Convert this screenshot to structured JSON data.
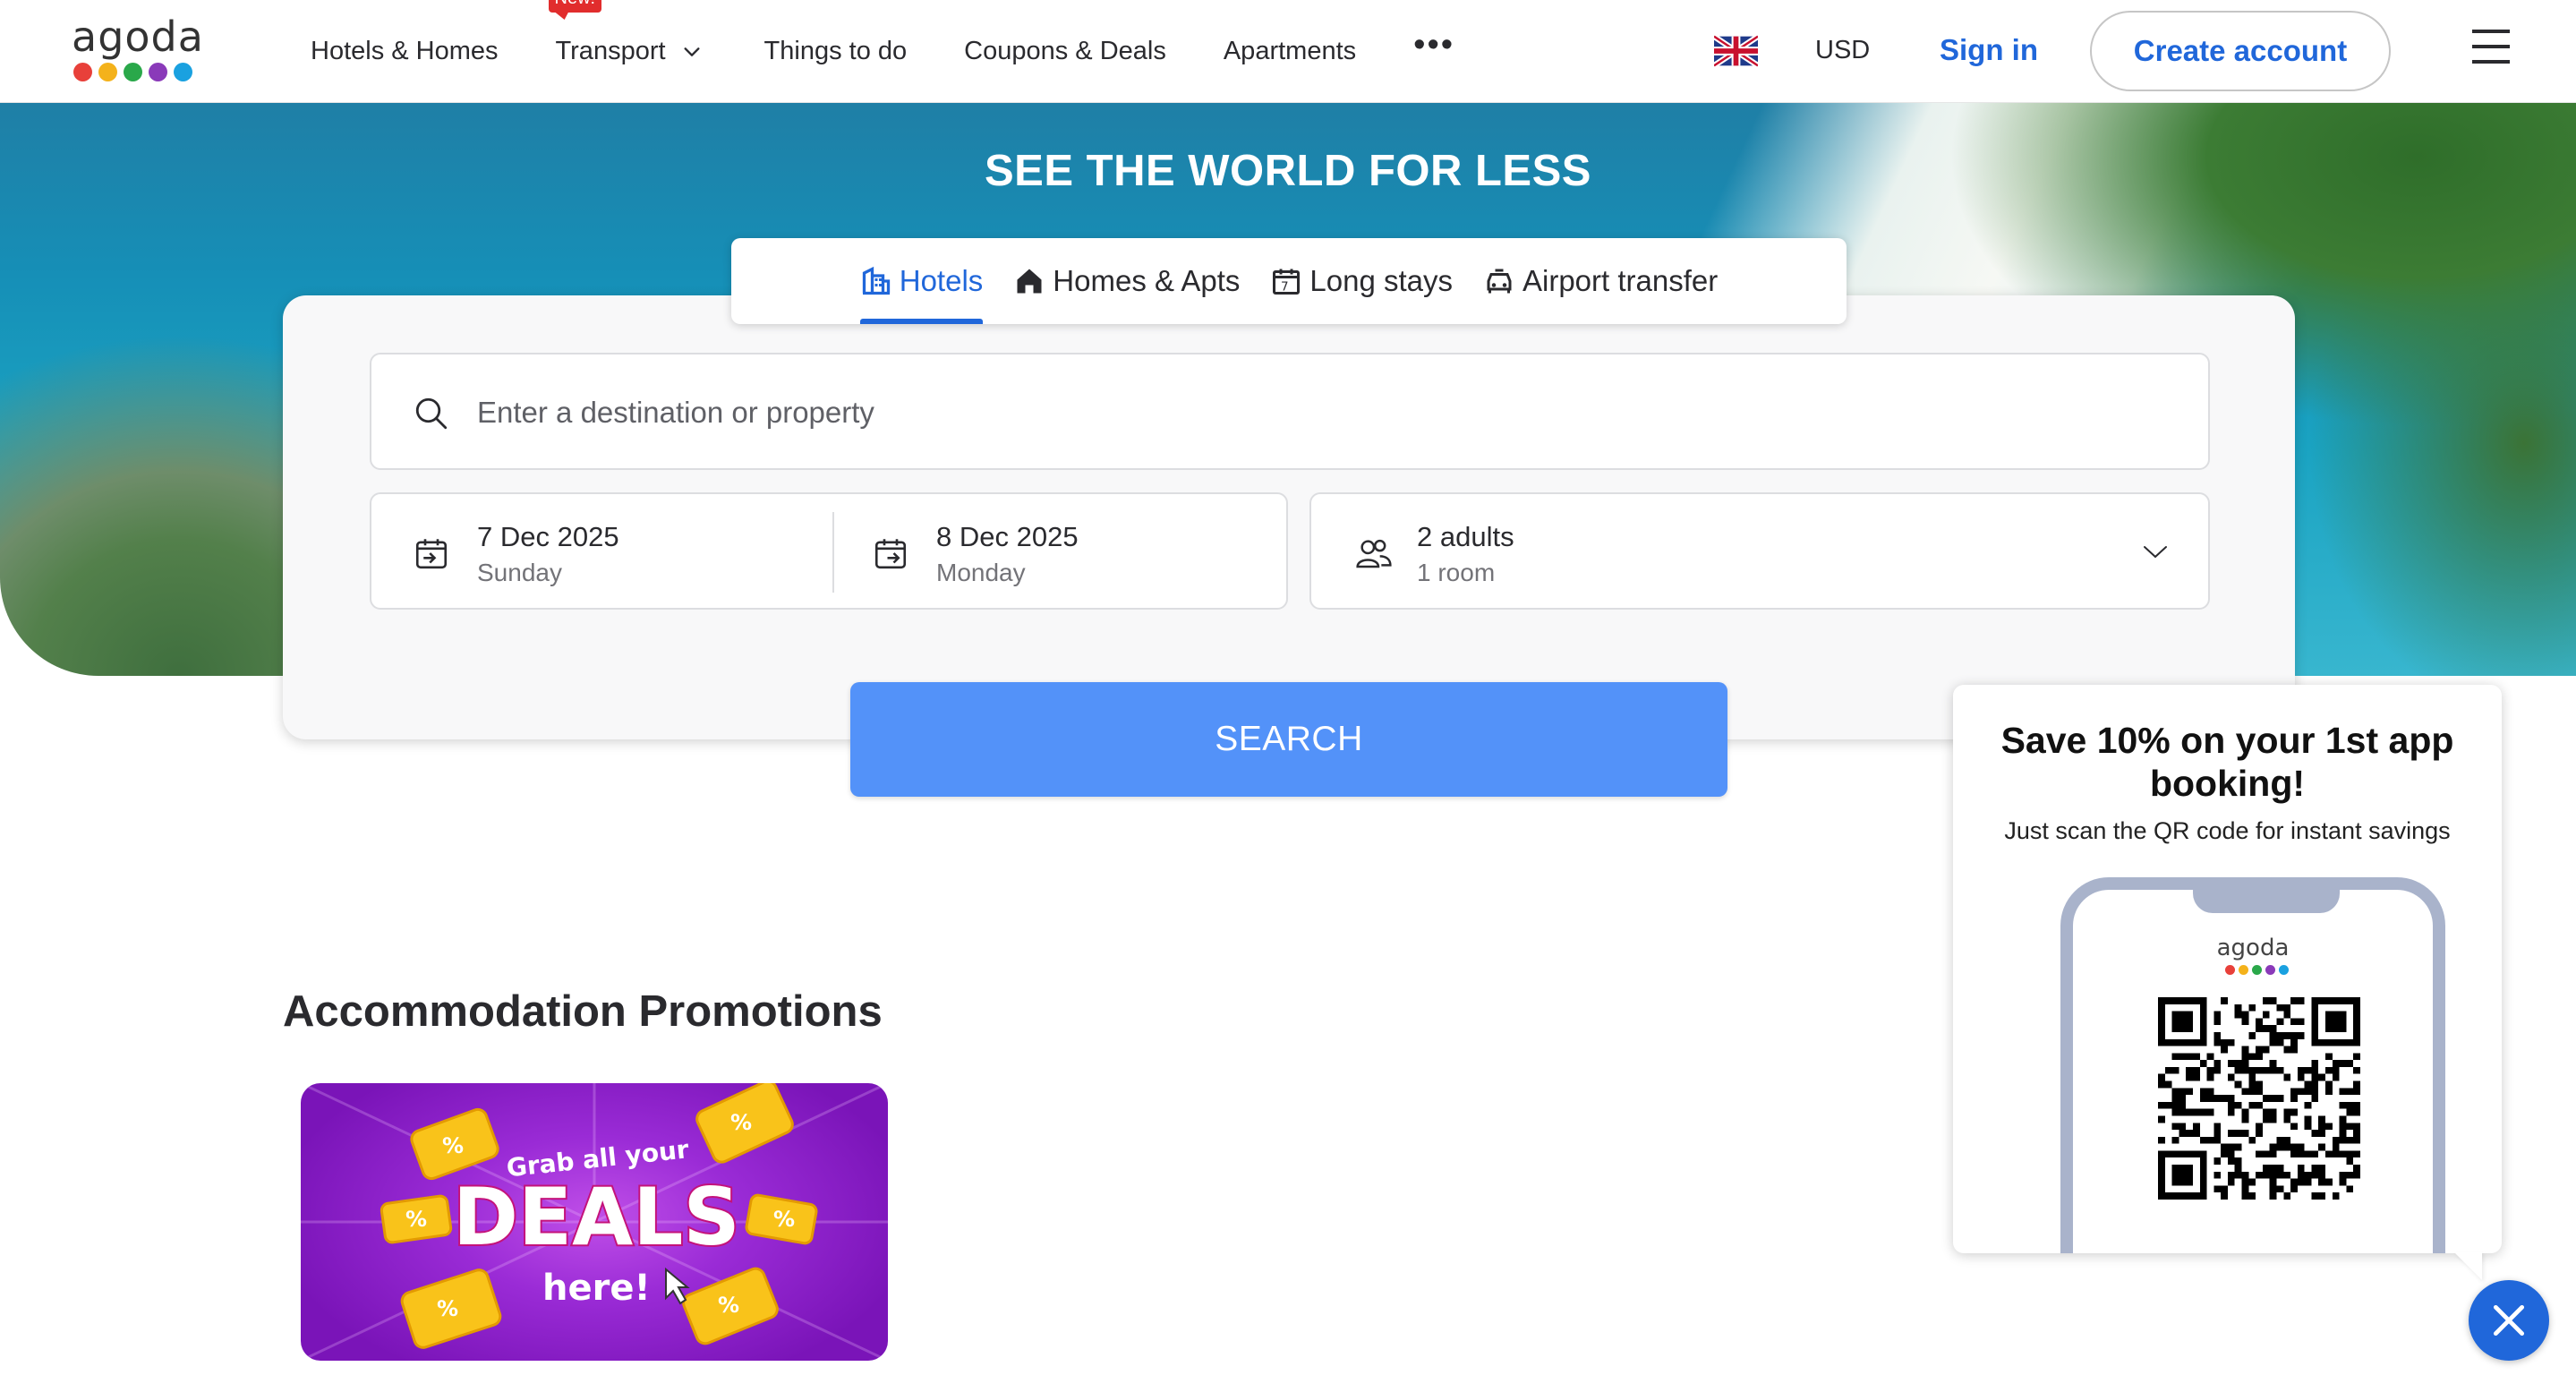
{
  "brand": {
    "name": "agoda",
    "dot_colors": [
      "#e8403a",
      "#f4b21b",
      "#2aa84a",
      "#8a3ab9",
      "#1aa1e0"
    ]
  },
  "nav": {
    "items": [
      {
        "label": "Hotels & Homes"
      },
      {
        "label": "Transport",
        "badge": "New!"
      },
      {
        "label": "Things to do"
      },
      {
        "label": "Coupons & Deals"
      },
      {
        "label": "Apartments"
      }
    ],
    "more_label": "•••"
  },
  "header": {
    "currency": "USD",
    "sign_in": "Sign in",
    "create_account": "Create account"
  },
  "hero": {
    "title": "SEE THE WORLD FOR LESS"
  },
  "search": {
    "tabs": [
      {
        "label": "Hotels",
        "icon": "hotel-building-icon",
        "active": true
      },
      {
        "label": "Homes & Apts",
        "icon": "house-icon",
        "active": false
      },
      {
        "label": "Long stays",
        "icon": "calendar-7-icon",
        "active": false
      },
      {
        "label": "Airport transfer",
        "icon": "car-icon",
        "active": false
      }
    ],
    "destination_placeholder": "Enter a destination or property",
    "check_in": {
      "date": "7 Dec 2025",
      "day": "Sunday"
    },
    "check_out": {
      "date": "8 Dec 2025",
      "day": "Monday"
    },
    "guests": {
      "main": "2 adults",
      "sub": "1 room"
    },
    "button": "SEARCH"
  },
  "promotions": {
    "title": "Accommodation Promotions",
    "card": {
      "line1": "Grab all your",
      "line2": "DEALS",
      "line3": "here!"
    }
  },
  "app_promo": {
    "title": "Save 10% on your 1st app booking!",
    "subtitle": "Just scan the QR code for instant savings",
    "phone_logo": "agoda"
  },
  "colors": {
    "accent": "#2067da",
    "search_button": "#5392f9",
    "badge": "#e12d2d"
  }
}
